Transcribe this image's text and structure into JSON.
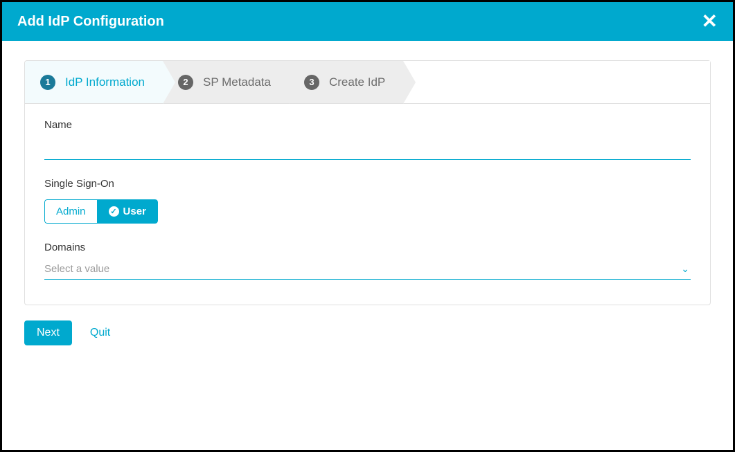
{
  "header": {
    "title": "Add IdP Configuration"
  },
  "steps": [
    {
      "num": "1",
      "label": "IdP Information",
      "state": "active"
    },
    {
      "num": "2",
      "label": "SP Metadata",
      "state": "inactive"
    },
    {
      "num": "3",
      "label": "Create IdP",
      "state": "inactive"
    }
  ],
  "form": {
    "name_label": "Name",
    "name_value": "",
    "sso_label": "Single Sign-On",
    "sso_options": {
      "admin": "Admin",
      "user": "User",
      "selected": "user"
    },
    "domains_label": "Domains",
    "domains_placeholder": "Select a value"
  },
  "footer": {
    "next": "Next",
    "quit": "Quit"
  },
  "colors": {
    "accent": "#00a9ce"
  }
}
